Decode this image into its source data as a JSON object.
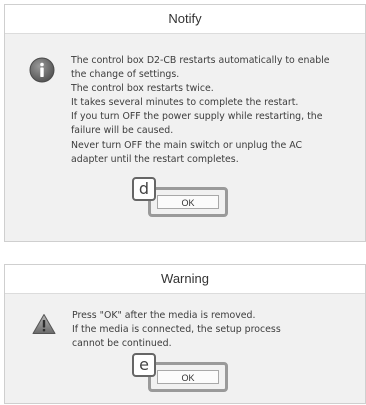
{
  "notify_dialog": {
    "title": "Notify",
    "icon": "info-icon",
    "message_lines": [
      "The control box D2-CB restarts automatically to enable",
      "the change of settings.",
      "The control box restarts twice.",
      "It takes several minutes to complete the restart.",
      "If you turn OFF the power supply while restarting, the",
      "failure will be caused.",
      "Never turn OFF the main switch or unplug the AC",
      "adapter until the restart completes."
    ],
    "ok_label": "OK",
    "callout_label": "d"
  },
  "warning_dialog": {
    "title": "Warning",
    "icon": "warning-icon",
    "message_lines": [
      "Press \"OK\" after the media is removed.",
      "If the media is connected, the setup process",
      "cannot be continued."
    ],
    "ok_label": "OK",
    "callout_label": "e"
  },
  "colors": {
    "dialog_bg": "#f1f1f1",
    "titlebar_bg": "#ffffff",
    "highlight_frame": "#9a9a9a",
    "info_icon": "#6e6e6e",
    "warning_icon": "#7a7a7a"
  }
}
